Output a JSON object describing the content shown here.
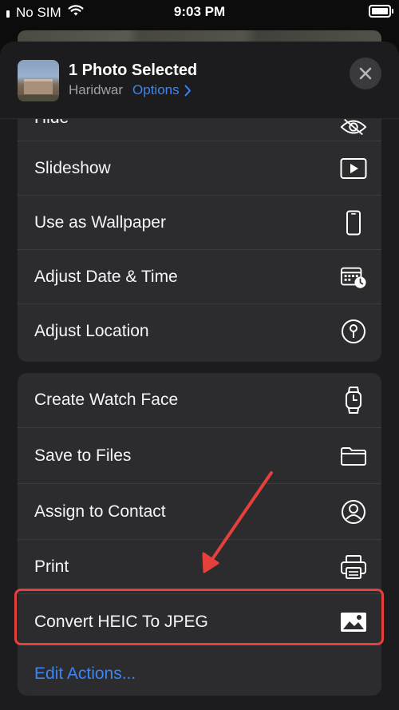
{
  "status_bar": {
    "carrier": "No SIM",
    "time": "9:03 PM"
  },
  "header": {
    "title": "1 Photo Selected",
    "location": "Haridwar",
    "options_label": "Options"
  },
  "group1": [
    {
      "label": "Hide",
      "icon": "eye-slash-icon"
    },
    {
      "label": "Slideshow",
      "icon": "play-icon"
    },
    {
      "label": "Use as Wallpaper",
      "icon": "phone-icon"
    },
    {
      "label": "Adjust Date & Time",
      "icon": "calendar-clock-icon"
    },
    {
      "label": "Adjust Location",
      "icon": "location-pin-icon"
    }
  ],
  "group2": [
    {
      "label": "Create Watch Face",
      "icon": "watch-icon"
    },
    {
      "label": "Save to Files",
      "icon": "folder-icon"
    },
    {
      "label": "Assign to Contact",
      "icon": "person-circle-icon"
    },
    {
      "label": "Print",
      "icon": "printer-icon"
    },
    {
      "label": "Convert HEIC To JPEG",
      "icon": "photo-icon"
    }
  ],
  "edit_actions_label": "Edit Actions...",
  "colors": {
    "accent": "#3a86f6",
    "highlight": "#e5403c",
    "sheet": "#1c1c1e",
    "group": "#2c2c2e"
  }
}
